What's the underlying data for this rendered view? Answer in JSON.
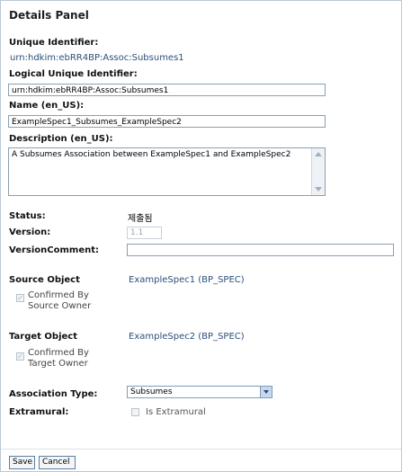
{
  "panel": {
    "title": "Details Panel"
  },
  "fields": {
    "unique_identifier": {
      "label": "Unique Identifier:",
      "value": "urn:hdkim:ebRR4BP:Assoc:Subsumes1"
    },
    "logical_unique_identifier": {
      "label": "Logical Unique Identifier:",
      "value": "urn:hdkim:ebRR4BP:Assoc:Subsumes1"
    },
    "name": {
      "label": "Name (en_US):",
      "value": "ExampleSpec1_Subsumes_ExampleSpec2"
    },
    "description": {
      "label": "Description (en_US):",
      "value": "A Subsumes Association between ExampleSpec1 and ExampleSpec2"
    },
    "status": {
      "label": "Status:",
      "value": "제출됨"
    },
    "version": {
      "label": "Version:",
      "value": "1.1"
    },
    "version_comment": {
      "label": "VersionComment:",
      "value": ""
    }
  },
  "source": {
    "label": "Source Object",
    "value": "ExampleSpec1 (BP_SPEC)",
    "confirm_line1": "Confirmed By",
    "confirm_line2": "Source Owner",
    "confirm_checked": true
  },
  "target": {
    "label": "Target Object",
    "value": "ExampleSpec2 (BP_SPEC)",
    "confirm_line1": "Confirmed By",
    "confirm_line2": "Target Owner",
    "confirm_checked": true
  },
  "association": {
    "type_label": "Association Type:",
    "type_value": "Subsumes",
    "extramural_label": "Extramural:",
    "extramural_checkbox_label": "Is Extramural",
    "extramural_checked": false
  },
  "buttons": {
    "save": "Save",
    "cancel": "Cancel"
  }
}
